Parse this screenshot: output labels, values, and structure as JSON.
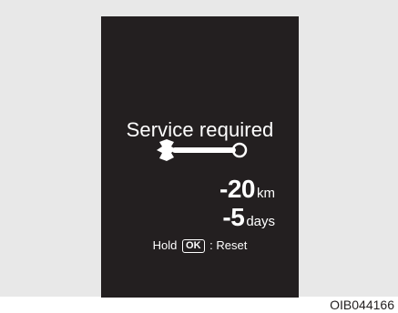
{
  "display": {
    "title": "Service required",
    "icon": "wrench-icon",
    "distance": {
      "value": "-20",
      "unit": "km"
    },
    "time": {
      "value": "-5",
      "unit": "days"
    },
    "reset": {
      "prefix": "Hold",
      "key": "OK",
      "suffix": ": Reset"
    }
  },
  "figure_id": "OIB044166",
  "colors": {
    "frame_background": "#e8e8e8",
    "display_background": "#231f20",
    "display_text": "#ffffff"
  }
}
